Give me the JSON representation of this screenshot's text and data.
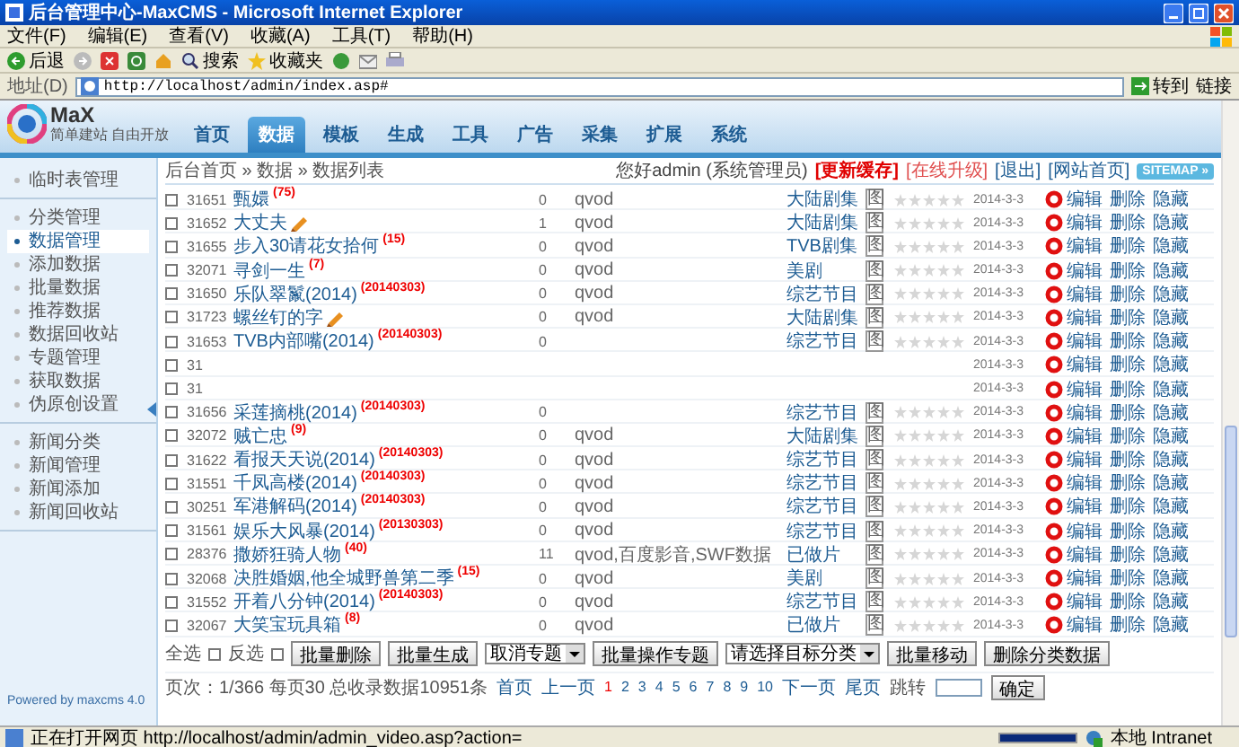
{
  "window": {
    "title": "后台管理中心-MaxCMS - Microsoft Internet Explorer"
  },
  "menu": [
    "文件(F)",
    "编辑(E)",
    "查看(V)",
    "收藏(A)",
    "工具(T)",
    "帮助(H)"
  ],
  "toolbar": {
    "back": "后退",
    "search": "搜索",
    "favorites": "收藏夹"
  },
  "address": {
    "label": "地址(D)",
    "url": "http://localhost/admin/index.asp#",
    "go": "转到",
    "links": "链接"
  },
  "logo": {
    "text": "MaX",
    "tagline": "简单建站 自由开放"
  },
  "nav": [
    {
      "label": "首页",
      "selected": false
    },
    {
      "label": "数据",
      "selected": true
    },
    {
      "label": "模板",
      "selected": false
    },
    {
      "label": "生成",
      "selected": false
    },
    {
      "label": "工具",
      "selected": false
    },
    {
      "label": "广告",
      "selected": false
    },
    {
      "label": "采集",
      "selected": false
    },
    {
      "label": "扩展",
      "selected": false
    },
    {
      "label": "系统",
      "selected": false
    }
  ],
  "breadcrumb": "后台首页 » 数据 » 数据列表",
  "user": {
    "greeting": "您好admin (系统管理员)",
    "links": [
      {
        "label": "[更新缓存]",
        "kind": "alert"
      },
      {
        "label": "[在线升级]",
        "kind": "warn"
      },
      {
        "label": "[退出]",
        "kind": "plain"
      },
      {
        "label": "[网站首页]",
        "kind": "plain"
      }
    ],
    "sitemap": "SITEMAP »"
  },
  "sidebar": {
    "groups": [
      [
        {
          "label": "临时表管理",
          "selected": false
        }
      ],
      [
        {
          "label": "分类管理",
          "selected": false
        },
        {
          "label": "数据管理",
          "selected": true
        },
        {
          "label": "添加数据",
          "selected": false
        },
        {
          "label": "批量数据",
          "selected": false
        },
        {
          "label": "推荐数据",
          "selected": false
        },
        {
          "label": "数据回收站",
          "selected": false
        },
        {
          "label": "专题管理",
          "selected": false
        },
        {
          "label": "获取数据",
          "selected": false
        },
        {
          "label": "伪原创设置",
          "selected": false
        }
      ],
      [
        {
          "label": "新闻分类",
          "selected": false
        },
        {
          "label": "新闻管理",
          "selected": false
        },
        {
          "label": "新闻添加",
          "selected": false
        },
        {
          "label": "新闻回收站",
          "selected": false
        }
      ]
    ],
    "footer": "Powered by maxcms 4.0"
  },
  "table": {
    "rows": [
      {
        "checked": false,
        "id": "31651",
        "title": "甄嬛",
        "tag": "(75)",
        "new": false,
        "count": "0",
        "source": "qvod",
        "category": "大陆剧集",
        "badge": "图",
        "stars": 0,
        "date": "2014-3-3",
        "actions": [
          "编辑",
          "删除",
          "隐藏"
        ]
      },
      {
        "checked": false,
        "id": "31652",
        "title": "大丈夫",
        "new": true,
        "count": "1",
        "source": "qvod",
        "category": "大陆剧集",
        "badge": "图",
        "stars": 0,
        "date": "2014-3-3",
        "actions": [
          "编辑",
          "删除",
          "隐藏"
        ]
      },
      {
        "checked": false,
        "id": "31655",
        "title": "步入30请花女拾何",
        "tag": "(15)",
        "new": false,
        "count": "0",
        "source": "qvod",
        "category": "TVB剧集",
        "badge": "图",
        "stars": 0,
        "date": "2014-3-3",
        "actions": [
          "编辑",
          "删除",
          "隐藏"
        ]
      },
      {
        "checked": false,
        "id": "32071",
        "title": "寻剑一生",
        "tag": "(7)",
        "new": false,
        "count": "0",
        "source": "qvod",
        "category": "美剧",
        "badge": "图",
        "stars": 0,
        "date": "2014-3-3",
        "actions": [
          "编辑",
          "删除",
          "隐藏"
        ]
      },
      {
        "checked": false,
        "id": "31650",
        "title": "乐队翠鬣(2014)",
        "tag": "(20140303)",
        "new": false,
        "count": "0",
        "source": "qvod",
        "category": "综艺节目",
        "badge": "图",
        "stars": 0,
        "date": "2014-3-3",
        "actions": [
          "编辑",
          "删除",
          "隐藏"
        ]
      },
      {
        "checked": false,
        "id": "31723",
        "title": "螺丝钉的字",
        "new": true,
        "count": "0",
        "source": "qvod",
        "category": "大陆剧集",
        "badge": "图",
        "stars": 0,
        "date": "2014-3-3",
        "actions": [
          "编辑",
          "删除",
          "隐藏"
        ]
      },
      {
        "checked": false,
        "id": "31653",
        "title": "TVB内部嘴(2014)",
        "tag": "(20140303)",
        "new": false,
        "count": "0",
        "category": "综艺节目",
        "badge": "图",
        "stars": 0,
        "date": "2014-3-3",
        "actions": [
          "编辑",
          "删除",
          "隐藏"
        ]
      },
      {
        "checked": false,
        "id": "31",
        "new": false,
        "date": "2014-3-3",
        "actions": [
          "编辑",
          "删除",
          "隐藏"
        ]
      },
      {
        "checked": false,
        "id": "31",
        "new": false,
        "date": "2014-3-3",
        "actions": [
          "编辑",
          "删除",
          "隐藏"
        ]
      },
      {
        "checked": false,
        "id": "31656",
        "title": "采莲摘桃(2014)",
        "tag": "(20140303)",
        "new": false,
        "count": "0",
        "category": "综艺节目",
        "badge": "图",
        "stars": 0,
        "date": "2014-3-3",
        "actions": [
          "编辑",
          "删除",
          "隐藏"
        ]
      },
      {
        "checked": false,
        "id": "32072",
        "title": "贼亡忠",
        "tag": "(9)",
        "new": false,
        "count": "0",
        "source": "qvod",
        "category": "大陆剧集",
        "badge": "图",
        "stars": 0,
        "date": "2014-3-3",
        "actions": [
          "编辑",
          "删除",
          "隐藏"
        ]
      },
      {
        "checked": false,
        "id": "31622",
        "title": "看报天天说(2014)",
        "tag": "(20140303)",
        "new": false,
        "count": "0",
        "source": "qvod",
        "category": "综艺节目",
        "badge": "图",
        "stars": 0,
        "date": "2014-3-3",
        "actions": [
          "编辑",
          "删除",
          "隐藏"
        ]
      },
      {
        "checked": false,
        "id": "31551",
        "title": "千凤高楼(2014)",
        "tag": "(20140303)",
        "new": false,
        "count": "0",
        "source": "qvod",
        "category": "综艺节目",
        "badge": "图",
        "stars": 0,
        "date": "2014-3-3",
        "actions": [
          "编辑",
          "删除",
          "隐藏"
        ]
      },
      {
        "checked": false,
        "id": "30251",
        "title": "军港解码(2014)",
        "tag": "(20140303)",
        "new": false,
        "count": "0",
        "source": "qvod",
        "category": "综艺节目",
        "badge": "图",
        "stars": 0,
        "date": "2014-3-3",
        "actions": [
          "编辑",
          "删除",
          "隐藏"
        ]
      },
      {
        "checked": false,
        "id": "31561",
        "title": "娱乐大风暴(2014)",
        "tag": "(20130303)",
        "new": false,
        "count": "0",
        "source": "qvod",
        "category": "综艺节目",
        "badge": "图",
        "stars": 0,
        "date": "2014-3-3",
        "actions": [
          "编辑",
          "删除",
          "隐藏"
        ]
      },
      {
        "checked": false,
        "id": "28376",
        "title": "撒娇狂骑人物",
        "tag": "(40)",
        "new": false,
        "count": "11",
        "source": "qvod,百度影音,SWF数据",
        "category": "已做片",
        "badge": "图",
        "stars": 0,
        "date": "2014-3-3",
        "actions": [
          "编辑",
          "删除",
          "隐藏"
        ]
      },
      {
        "checked": false,
        "id": "32068",
        "title": "决胜婚姻,他全城野兽第二季",
        "tag": "(15)",
        "new": false,
        "count": "0",
        "source": "qvod",
        "category": "美剧",
        "badge": "图",
        "stars": 0,
        "date": "2014-3-3",
        "actions": [
          "编辑",
          "删除",
          "隐藏"
        ]
      },
      {
        "checked": false,
        "id": "31552",
        "title": "开着八分钟(2014)",
        "tag": "(20140303)",
        "new": false,
        "count": "0",
        "source": "qvod",
        "category": "综艺节目",
        "badge": "图",
        "stars": 0,
        "date": "2014-3-3",
        "actions": [
          "编辑",
          "删除",
          "隐藏"
        ]
      },
      {
        "checked": false,
        "id": "32067",
        "title": "大笑宝玩具箱",
        "tag": "(8)",
        "new": false,
        "count": "0",
        "source": "qvod",
        "category": "已做片",
        "badge": "图",
        "stars": 0,
        "date": "2014-3-3",
        "actions": [
          "编辑",
          "删除",
          "隐藏"
        ]
      }
    ]
  },
  "batch": {
    "select_all": {
      "label": "全选",
      "checked": false
    },
    "invert": {
      "label": "反选",
      "checked": false
    },
    "items": [
      {
        "kind": "button",
        "label": "批量删除"
      },
      {
        "kind": "button",
        "label": "批量生成"
      },
      {
        "kind": "select",
        "value": "取消专题"
      },
      {
        "kind": "button",
        "label": "批量操作专题"
      },
      {
        "kind": "select",
        "value": "请选择目标分类"
      },
      {
        "kind": "button",
        "label": "批量移动"
      },
      {
        "kind": "button",
        "label": "删除分类数据"
      }
    ]
  },
  "pagination": {
    "summary": "页次：1/366 每页30 总收录数据10951条",
    "before": [
      "首页",
      "上一页"
    ],
    "pages": [
      {
        "label": "1",
        "selected": true
      },
      {
        "label": "2",
        "selected": false
      },
      {
        "label": "3",
        "selected": false
      },
      {
        "label": "4",
        "selected": false
      },
      {
        "label": "5",
        "selected": false
      },
      {
        "label": "6",
        "selected": false
      },
      {
        "label": "7",
        "selected": false
      },
      {
        "label": "8",
        "selected": false
      },
      {
        "label": "9",
        "selected": false
      },
      {
        "label": "10",
        "selected": false
      }
    ],
    "after": [
      "下一页",
      "尾页"
    ],
    "jump": "跳转",
    "confirm": "确定"
  },
  "status": {
    "text": "正在打开网页 http://localhost/admin/admin_video.asp?action=",
    "progress": {
      "level": 1
    },
    "zone": "本地 Intranet"
  }
}
